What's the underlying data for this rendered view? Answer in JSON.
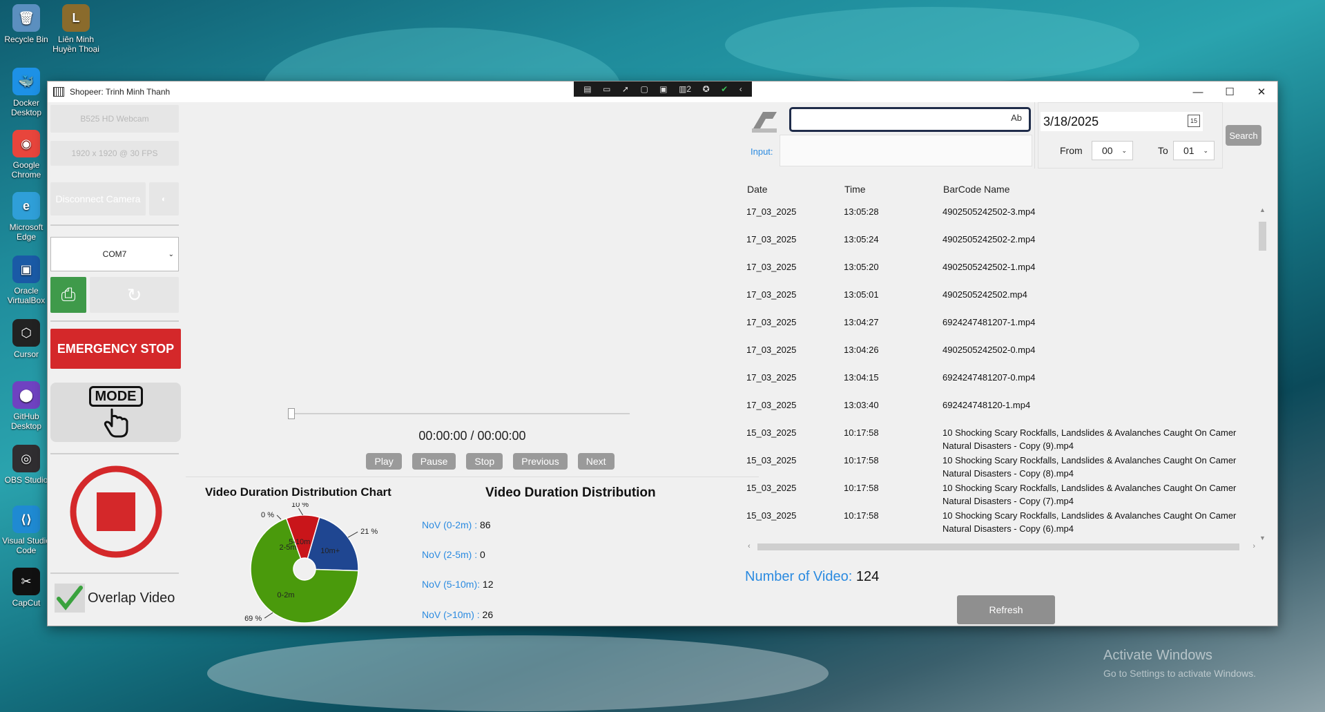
{
  "desktop": {
    "icons": [
      {
        "label": "Recycle Bin",
        "color": "#5b8fbf",
        "glyph": "🗑"
      },
      {
        "label": "Liên Minh Huyền Thoại",
        "color": "#8a6b2c",
        "glyph": "L"
      },
      {
        "label": "Docker Desktop",
        "color": "#1d91e6",
        "glyph": "🐳"
      },
      {
        "label": "Google Chrome",
        "color": "#e8453c",
        "glyph": "◉"
      },
      {
        "label": "Microsoft Edge",
        "color": "#2f9fd8",
        "glyph": "e"
      },
      {
        "label": "Oracle VirtualBox",
        "color": "#1a5aa6",
        "glyph": "▣"
      },
      {
        "label": "Cursor",
        "color": "#222222",
        "glyph": "⬡"
      },
      {
        "label": "GitHub Desktop",
        "color": "#6f42c1",
        "glyph": "⬤"
      },
      {
        "label": "OBS Studio",
        "color": "#302e31",
        "glyph": "◎"
      },
      {
        "label": "Visual Studio Code",
        "color": "#1f8ad2",
        "glyph": "⟨⟩"
      },
      {
        "label": "CapCut",
        "color": "#111111",
        "glyph": "✂"
      }
    ],
    "watermark": {
      "line1": "Activate Windows",
      "line2": "Go to Settings to activate Windows."
    }
  },
  "window": {
    "title": "Shopeer: Trinh Minh Thanh",
    "minimize": "—",
    "maximize": "☐",
    "close": "✕"
  },
  "left": {
    "camera": "B525 HD Webcam",
    "resolution": "1920 x 1920 @ 30 FPS",
    "disconnect": "Disconnect Camera",
    "com_port": "COM7",
    "emergency_stop": "EMERGENCY STOP",
    "mode_label": "MODE",
    "overlap_label": "Overlap Video"
  },
  "player": {
    "time": "00:00:00 / 00:00:00",
    "buttons": [
      "Play",
      "Pause",
      "Stop",
      "Previous",
      "Next"
    ],
    "progress": 0
  },
  "stats": {
    "chart_title": "Video Duration Distribution Chart",
    "dist_title": "Video Duration Distribution",
    "rows": [
      {
        "key": "NoV (0-2m) :",
        "value": "86"
      },
      {
        "key": "NoV (2-5m) :",
        "value": "0"
      },
      {
        "key": "NoV (5-10m):",
        "value": "12"
      },
      {
        "key": "NoV (>10m) :",
        "value": "26"
      }
    ]
  },
  "chart_data": {
    "type": "pie",
    "title": "Video Duration Distribution Chart",
    "donut": true,
    "slices": [
      {
        "label": "0-2m",
        "value": 69,
        "pct_label": "69 %",
        "color": "#4a9a0c"
      },
      {
        "label": "2-5m",
        "value": 0,
        "pct_label": "0 %",
        "color": "#e8a33b"
      },
      {
        "label": "5-10m",
        "value": 10,
        "pct_label": "10 %",
        "color": "#c9151a"
      },
      {
        "label": "10m+",
        "value": 21,
        "pct_label": "21 %",
        "color": "#1f4691"
      }
    ]
  },
  "right": {
    "input_label": "Input:",
    "search_value": "",
    "input_hint": "Ab",
    "date": "3/18/2025",
    "calendar_glyph": "15",
    "search_button": "Search",
    "from_label": "From",
    "from_value": "00",
    "to_label": "To",
    "to_value": "01",
    "headers": [
      "Date",
      "Time",
      "BarCode Name"
    ],
    "rows": [
      {
        "date": "17_03_2025",
        "time": "13:05:28",
        "name": "4902505242502-3.mp4",
        "name2": ""
      },
      {
        "date": "17_03_2025",
        "time": "13:05:24",
        "name": "4902505242502-2.mp4",
        "name2": ""
      },
      {
        "date": "17_03_2025",
        "time": "13:05:20",
        "name": "4902505242502-1.mp4",
        "name2": ""
      },
      {
        "date": "17_03_2025",
        "time": "13:05:01",
        "name": "4902505242502.mp4",
        "name2": ""
      },
      {
        "date": "17_03_2025",
        "time": "13:04:27",
        "name": "6924247481207-1.mp4",
        "name2": ""
      },
      {
        "date": "17_03_2025",
        "time": "13:04:26",
        "name": "4902505242502-0.mp4",
        "name2": ""
      },
      {
        "date": "17_03_2025",
        "time": "13:04:15",
        "name": "6924247481207-0.mp4",
        "name2": ""
      },
      {
        "date": "17_03_2025",
        "time": "13:03:40",
        "name": "692424748120-1.mp4",
        "name2": ""
      },
      {
        "date": "15_03_2025",
        "time": "10:17:58",
        "name": "10 Shocking Scary Rockfalls, Landslides & Avalanches Caught On Camer",
        "name2": "Natural Disasters - Copy (9).mp4"
      },
      {
        "date": "15_03_2025",
        "time": "10:17:58",
        "name": "10 Shocking Scary Rockfalls, Landslides & Avalanches Caught On Camer",
        "name2": "Natural Disasters - Copy (8).mp4"
      },
      {
        "date": "15_03_2025",
        "time": "10:17:58",
        "name": "10 Shocking Scary Rockfalls, Landslides & Avalanches Caught On Camer",
        "name2": "Natural Disasters - Copy (7).mp4"
      },
      {
        "date": "15_03_2025",
        "time": "10:17:58",
        "name": "10 Shocking Scary Rockfalls, Landslides & Avalanches Caught On Camer",
        "name2": "Natural Disasters - Copy (6).mp4"
      }
    ],
    "nov_label": "Number of Video:",
    "nov_value": "124",
    "refresh": "Refresh"
  }
}
